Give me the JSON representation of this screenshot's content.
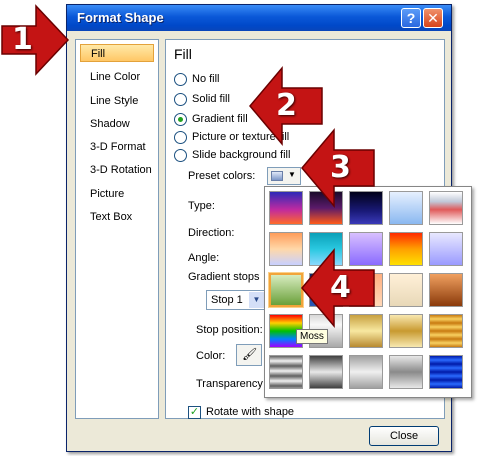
{
  "window": {
    "title": "Format Shape",
    "help_label": "?",
    "close_x_label": "✕"
  },
  "nav": {
    "items": [
      {
        "label": "Fill",
        "selected": true
      },
      {
        "label": "Line Color"
      },
      {
        "label": "Line Style"
      },
      {
        "label": "Shadow"
      },
      {
        "label": "3-D Format"
      },
      {
        "label": "3-D Rotation"
      },
      {
        "label": "Picture"
      },
      {
        "label": "Text Box"
      }
    ]
  },
  "fill": {
    "section_title": "Fill",
    "options": [
      {
        "label": "No fill",
        "checked": false
      },
      {
        "label": "Solid fill",
        "checked": false
      },
      {
        "label": "Gradient fill",
        "checked": true
      },
      {
        "label": "Picture or texture fill",
        "checked": false
      },
      {
        "label": "Slide background fill",
        "checked": false
      }
    ],
    "preset_colors_label": "Preset colors:",
    "type_label": "Type:",
    "direction_label": "Direction:",
    "angle_label": "Angle:",
    "gradient_stops_label": "Gradient stops",
    "stop_select_value": "Stop 1",
    "stop_position_label": "Stop position:",
    "color_label": "Color:",
    "transparency_label": "Transparency",
    "rotate_label": "Rotate with shape",
    "rotate_checked": true
  },
  "buttons": {
    "close_label": "Close"
  },
  "gallery": {
    "tooltip": "Moss",
    "swatches": [
      {
        "gradient": "linear-gradient(#2d2ab8, #c02aa0 55%, #ff6a2a)"
      },
      {
        "gradient": "linear-gradient(#1a0a2a, #5a1a6a 50%, #ff5a1a)"
      },
      {
        "gradient": "linear-gradient(#000018, #1a1a78 60%, #3a3ab8)"
      },
      {
        "gradient": "linear-gradient(#e6f0ff, #8ab8f0)"
      },
      {
        "gradient": "linear-gradient(#ffffff, #c0c8d8 30%, #e05a5a 55%, #ffffff)"
      },
      {
        "gradient": "linear-gradient(#ff9c5a, #ffd8a8 50%, #c8d0ff)"
      },
      {
        "gradient": "linear-gradient(#0aa0b8, #2ac8e0 50%, #8ad8ff)"
      },
      {
        "gradient": "linear-gradient(#d8c0ff, #8a6aff)"
      },
      {
        "gradient": "linear-gradient(#ff2a00, #ffa000 50%, #ffe000)"
      },
      {
        "gradient": "linear-gradient(#e8e8ff, #9a9aff)"
      },
      {
        "gradient": "linear-gradient(#d8ecc0, #6aa03a)",
        "hover": true
      },
      {
        "gradient": "linear-gradient(#0a2a6a, #2a5ab8)"
      },
      {
        "gradient": "linear-gradient(#ffb080, #ffd8b8)"
      },
      {
        "gradient": "linear-gradient(#fff0d8, #e8d8b8)"
      },
      {
        "gradient": "linear-gradient(#f0a060, #8a3a0a)"
      },
      {
        "gradient": "linear-gradient(#ff0000, #ffd000 25%, #00c000 50%, #0080ff 75%, #a000ff)"
      },
      {
        "gradient": "linear-gradient(#d8d8d8, #f8f8f8 30%, #a8a8a8)"
      },
      {
        "gradient": "linear-gradient(#c8a040, #f8e8a0 50%, #b88a30)"
      },
      {
        "gradient": "linear-gradient(#f8e8b0, #c89a30 50%, #f8e8b0)"
      },
      {
        "gradient": "repeating-linear-gradient(#c87a10 0px, #f8d060 4px, #c87a10 8px)"
      },
      {
        "gradient": "repeating-linear-gradient(#606060 0px, #f0f0f0 5px, #606060 10px)"
      },
      {
        "gradient": "linear-gradient(#404040, #e8e8e8 50%, #404040)"
      },
      {
        "gradient": "linear-gradient(#a0a0a0, #f0f0f0 50%, #a0a0a0)"
      },
      {
        "gradient": "linear-gradient(#e8e8e8, #8a8a8a 50%, #e8e8e8)"
      },
      {
        "gradient": "repeating-linear-gradient(#001aa8 0px, #2a6aff 4px, #001aa8 8px)"
      }
    ]
  },
  "callouts": [
    "1",
    "2",
    "3",
    "4"
  ],
  "colors": {
    "title_bar": "#0a58d8",
    "callout_red": "#c41414",
    "selection_orange": "#ffc766"
  }
}
